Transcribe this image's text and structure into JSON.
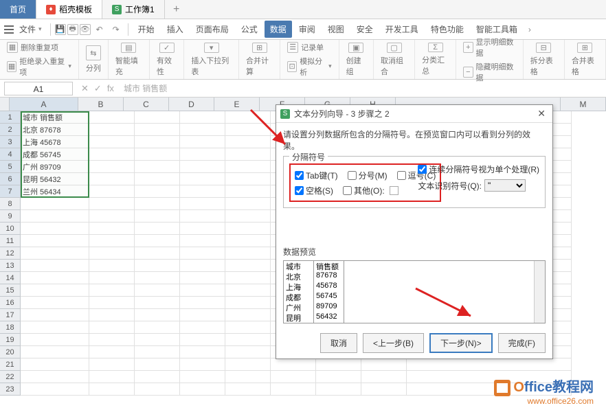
{
  "tabs": {
    "home": "首页",
    "template": "稻壳模板",
    "workbook": "工作簿1",
    "add": "+"
  },
  "menu": {
    "file": "文件",
    "items": [
      "开始",
      "插入",
      "页面布局",
      "公式",
      "数据",
      "审阅",
      "视图",
      "安全",
      "开发工具",
      "特色功能",
      "智能工具箱"
    ]
  },
  "ribbon": {
    "delete_dup": "删除重复项",
    "reject_dup": "拒绝录入重复项",
    "split_col": "分列",
    "smart_fill": "智能填充",
    "validity": "有效性",
    "insert_dropdown": "插入下拉列表",
    "consolidate": "合并计算",
    "record_sheet": "记录单",
    "whatif": "模拟分析",
    "create_group": "创建组",
    "ungroup": "取消组合",
    "subtotal": "分类汇总",
    "show_detail": "显示明细数据",
    "hide_detail": "隐藏明细数据",
    "split_table": "拆分表格",
    "merge_table": "合并表格"
  },
  "namebox": "A1",
  "fx": {
    "cancel": "✕",
    "enter": "✓",
    "fx": "fx"
  },
  "formula_hint": "城市  销售额",
  "columns": [
    "A",
    "B",
    "C",
    "D",
    "E",
    "F",
    "G",
    "H",
    "M"
  ],
  "rows_count": 23,
  "data_rows": [
    [
      "城市  销售额",
      ""
    ],
    [
      "北京  87678",
      ""
    ],
    [
      "上海  45678",
      ""
    ],
    [
      "成都  56745",
      ""
    ],
    [
      "广州  89709",
      ""
    ],
    [
      "昆明  56432",
      ""
    ],
    [
      "兰州  56434",
      ""
    ]
  ],
  "dialog": {
    "title": "文本分列向导 - 3 步骤之 2",
    "desc": "请设置分列数据所包含的分隔符号。在预览窗口内可以看到分列的效果。",
    "legend": "分隔符号",
    "tab": "Tab键(T)",
    "semicolon": "分号(M)",
    "comma": "逗号(C)",
    "space": "空格(S)",
    "other": "其他(O):",
    "treat_consecutive": "连续分隔符号视为单个处理(R)",
    "text_qualifier_label": "文本识别符号(Q):",
    "text_qualifier_value": "\"",
    "preview_label": "数据预览",
    "preview": [
      [
        "城市",
        "销售额"
      ],
      [
        "北京",
        "87678"
      ],
      [
        "上海",
        "45678"
      ],
      [
        "成都",
        "56745"
      ],
      [
        "广州",
        "89709"
      ],
      [
        "昆明",
        "56432"
      ]
    ],
    "buttons": {
      "cancel": "取消",
      "back": "<上一步(B)",
      "next": "下一步(N)>",
      "finish": "完成(F)"
    }
  },
  "watermark": {
    "title_prefix": "O",
    "title_rest": "ffice教程网",
    "url": "www.office26.com"
  },
  "chart_data": {
    "type": "table",
    "title": "城市 销售额",
    "columns": [
      "城市",
      "销售额"
    ],
    "rows": [
      [
        "北京",
        87678
      ],
      [
        "上海",
        45678
      ],
      [
        "成都",
        56745
      ],
      [
        "广州",
        89709
      ],
      [
        "昆明",
        56432
      ],
      [
        "兰州",
        56434
      ]
    ]
  }
}
